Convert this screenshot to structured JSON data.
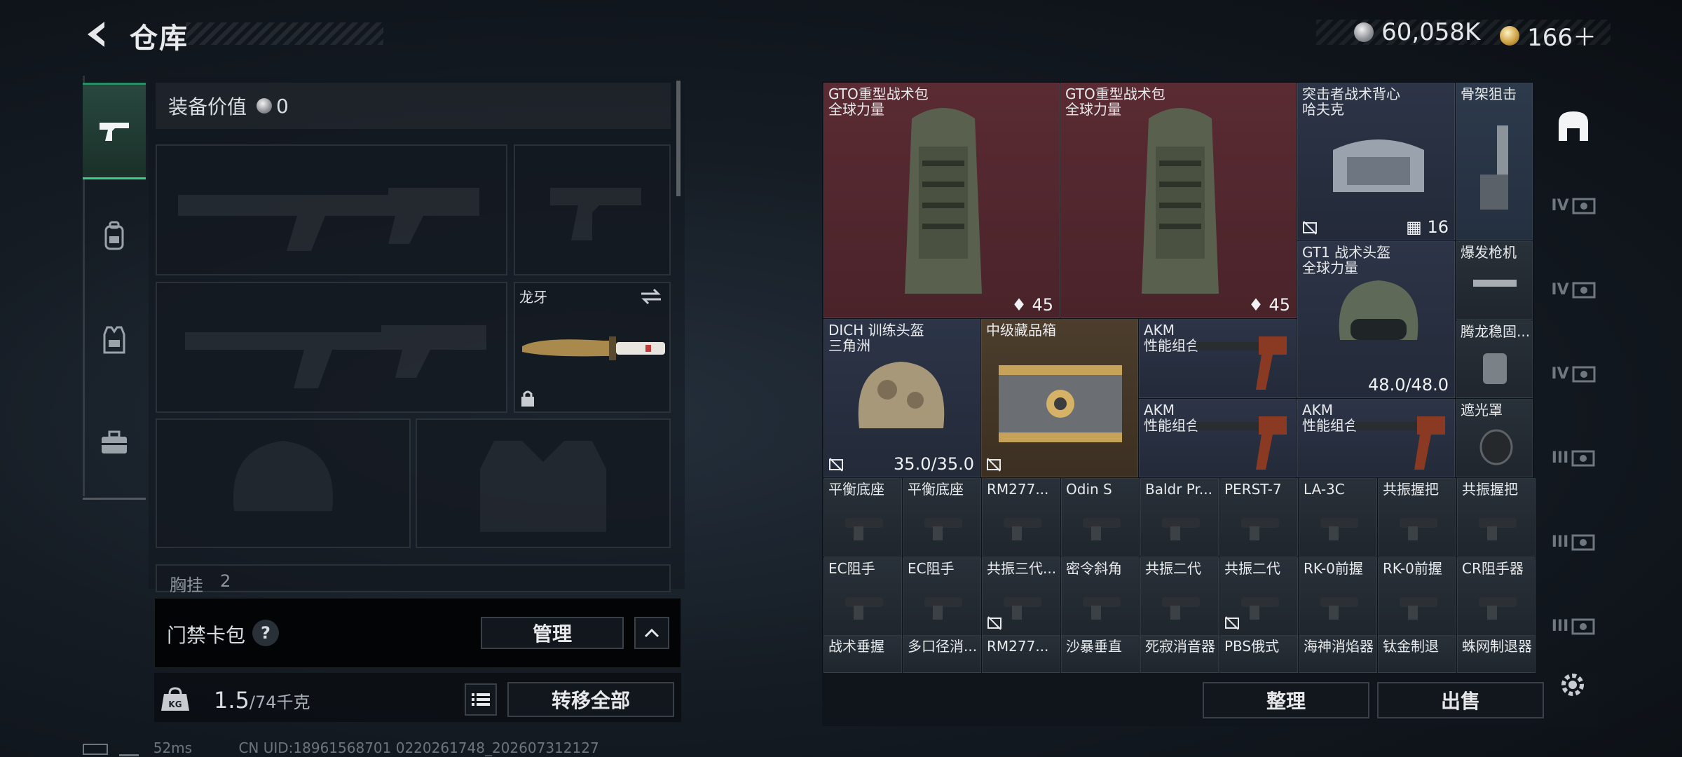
{
  "header": {
    "title": "仓库",
    "silver": "60,058K",
    "gold": "166＋"
  },
  "equip": {
    "label": "装备价值",
    "value": "0",
    "knife_name": "龙牙",
    "chest_label": "胸挂",
    "chest_count": "2"
  },
  "access": {
    "label": "门禁卡包",
    "help": "?",
    "manage": "管理"
  },
  "weight": {
    "current": "1.5",
    "capacity": "/74千克",
    "transfer": "转移全部"
  },
  "grid": {
    "gto1": {
      "name": "GTO重型战术包",
      "sub": "全球力量",
      "value": "45"
    },
    "gto2": {
      "name": "GTO重型战术包",
      "sub": "全球力量",
      "value": "45"
    },
    "vest": {
      "name": "突击者战术背心",
      "sub": "哈夫克",
      "value": "16"
    },
    "stock": {
      "name": "骨架狙击"
    },
    "gt1": {
      "name": "GT1 战术头盔",
      "sub": "全球力量",
      "value": "48.0/48.0"
    },
    "burst": {
      "name": "爆发枪机"
    },
    "dich": {
      "name": "DICH 训练头盔",
      "sub": "三角洲",
      "value": "35.0/35.0"
    },
    "box": {
      "name": "中级藏品箱"
    },
    "akm1": {
      "name": "AKM",
      "sub": "性能组合"
    },
    "tenglong": {
      "name": "腾龙稳固..."
    },
    "akm2": {
      "name": "AKM",
      "sub": "性能组合"
    },
    "akm3": {
      "name": "AKM",
      "sub": "性能组合"
    },
    "shade": {
      "name": "遮光罩"
    },
    "row5": [
      "平衡底座",
      "平衡底座",
      "RM277...",
      "Odin S",
      "Baldr Pr...",
      "PERST-7",
      "LA-3C",
      "共振握把",
      "共振握把"
    ],
    "row6": [
      "EC阻手",
      "EC阻手",
      "共振三代...",
      "密令斜角",
      "共振二代",
      "共振二代",
      "RK-0前握",
      "RK-0前握",
      "CR阻手器"
    ],
    "row7": [
      "战术垂握",
      "多口径消...",
      "RM277...",
      "沙暴垂直",
      "死寂消音器",
      "PBS俄式",
      "海神消焰器",
      "钛金制退",
      "蛛网制退器"
    ]
  },
  "actions": {
    "sort": "整理",
    "sell": "出售"
  },
  "rail": [
    "IV",
    "IV",
    "IV",
    "III",
    "III",
    "III"
  ],
  "status": {
    "ping": "52ms",
    "uid": "CN UID:18961568701 0220261748_202607312127"
  }
}
